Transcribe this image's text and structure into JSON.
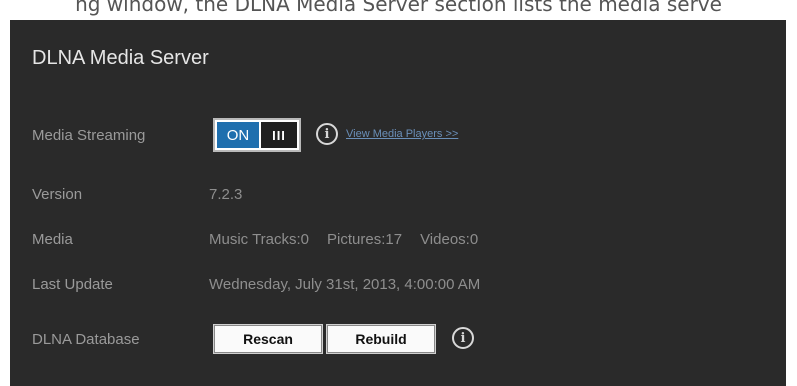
{
  "top_text": "ng window, the DLNA Media Server section lists the media serve",
  "title": "DLNA Media Server",
  "media_streaming": {
    "label": "Media Streaming",
    "toggle_on_label": "ON",
    "toggle_off_label": "III",
    "enabled": true,
    "info_icon": "info-icon",
    "link_text": "View Media Players >>"
  },
  "version": {
    "label": "Version",
    "value": "7.2.3"
  },
  "media": {
    "label": "Media",
    "music": "Music Tracks:0",
    "pictures": "Pictures:17",
    "videos": "Videos:0"
  },
  "last_update": {
    "label": "Last Update",
    "value": "Wednesday, July 31st, 2013, 4:00:00 AM"
  },
  "dlna_database": {
    "label": "DLNA Database",
    "rescan_label": "Rescan",
    "rebuild_label": "Rebuild",
    "info_icon": "info-icon"
  },
  "colors": {
    "panel_bg": "#2a2a2a",
    "toggle_on": "#1f6fae",
    "link": "#6a8fb8"
  }
}
